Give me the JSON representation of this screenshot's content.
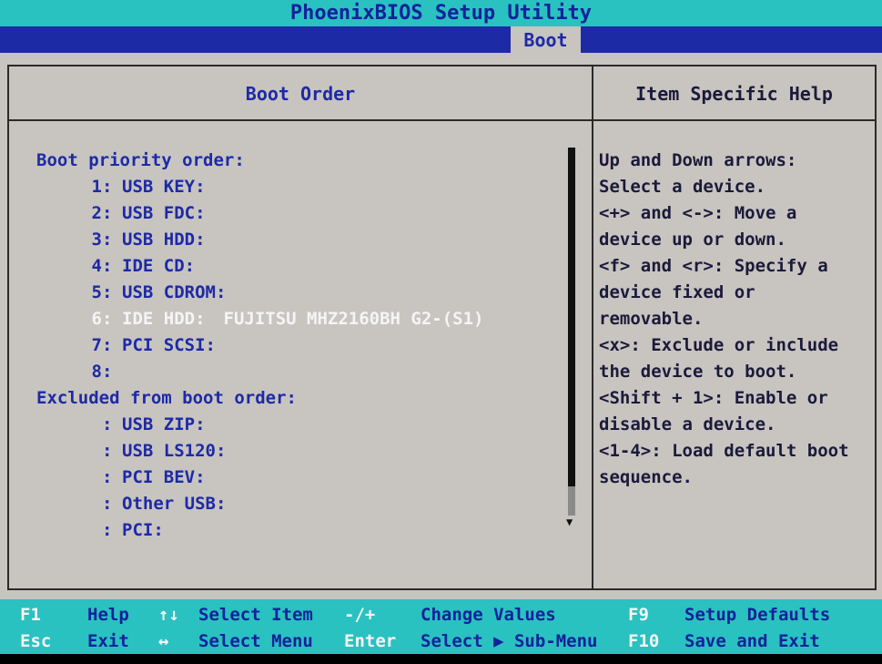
{
  "title": "PhoenixBIOS Setup Utility",
  "menu": {
    "active_tab": "Boot"
  },
  "panel": {
    "left_header": "Boot Order",
    "right_header": "Item Specific Help"
  },
  "boot_priority": {
    "label": "Boot priority order:",
    "items": [
      {
        "num": "1",
        "device": "USB KEY:",
        "value": ""
      },
      {
        "num": "2",
        "device": "USB FDC:",
        "value": ""
      },
      {
        "num": "3",
        "device": "USB HDD:",
        "value": ""
      },
      {
        "num": "4",
        "device": "IDE CD:",
        "value": ""
      },
      {
        "num": "5",
        "device": "USB CDROM:",
        "value": ""
      },
      {
        "num": "6",
        "device": "IDE HDD:",
        "value": "FUJITSU MHZ2160BH G2-(S1)",
        "selected": true
      },
      {
        "num": "7",
        "device": "PCI SCSI:",
        "value": ""
      },
      {
        "num": "8",
        "device": "",
        "value": ""
      }
    ]
  },
  "excluded": {
    "label": "Excluded from boot order:",
    "items": [
      {
        "device": "USB ZIP:"
      },
      {
        "device": "USB LS120:"
      },
      {
        "device": "PCI BEV:"
      },
      {
        "device": "Other USB:"
      },
      {
        "device": "PCI:"
      }
    ]
  },
  "help_lines": [
    "Up and Down arrows:",
    "Select a device.",
    "<+> and <->: Move a",
    "device up or down.",
    "<f> and <r>: Specify a",
    "device fixed or",
    "removable.",
    "<x>: Exclude or include",
    "the device to boot.",
    "<Shift + 1>: Enable or",
    "disable a device.",
    "<1-4>: Load default boot",
    "sequence."
  ],
  "footer": {
    "row1": {
      "k1": "F1",
      "a1": "Help",
      "k2": "↑↓",
      "a2": "Select Item",
      "k3": "-/+",
      "a3": "Change Values",
      "k4": "F9",
      "a4": "Setup Defaults"
    },
    "row2": {
      "k1": "Esc",
      "a1": "Exit",
      "k2": "↔",
      "a2": "Select Menu",
      "k3": "Enter",
      "a3": "Select ▶ Sub-Menu",
      "k4": "F10",
      "a4": "Save and Exit"
    }
  },
  "colors": {
    "title_bg": "#2ac1c1",
    "menu_bg": "#1d2aa6",
    "panel_bg": "#c8c4c0",
    "text_blue": "#1d2aa6",
    "selected_text": "#f5f5f5"
  }
}
